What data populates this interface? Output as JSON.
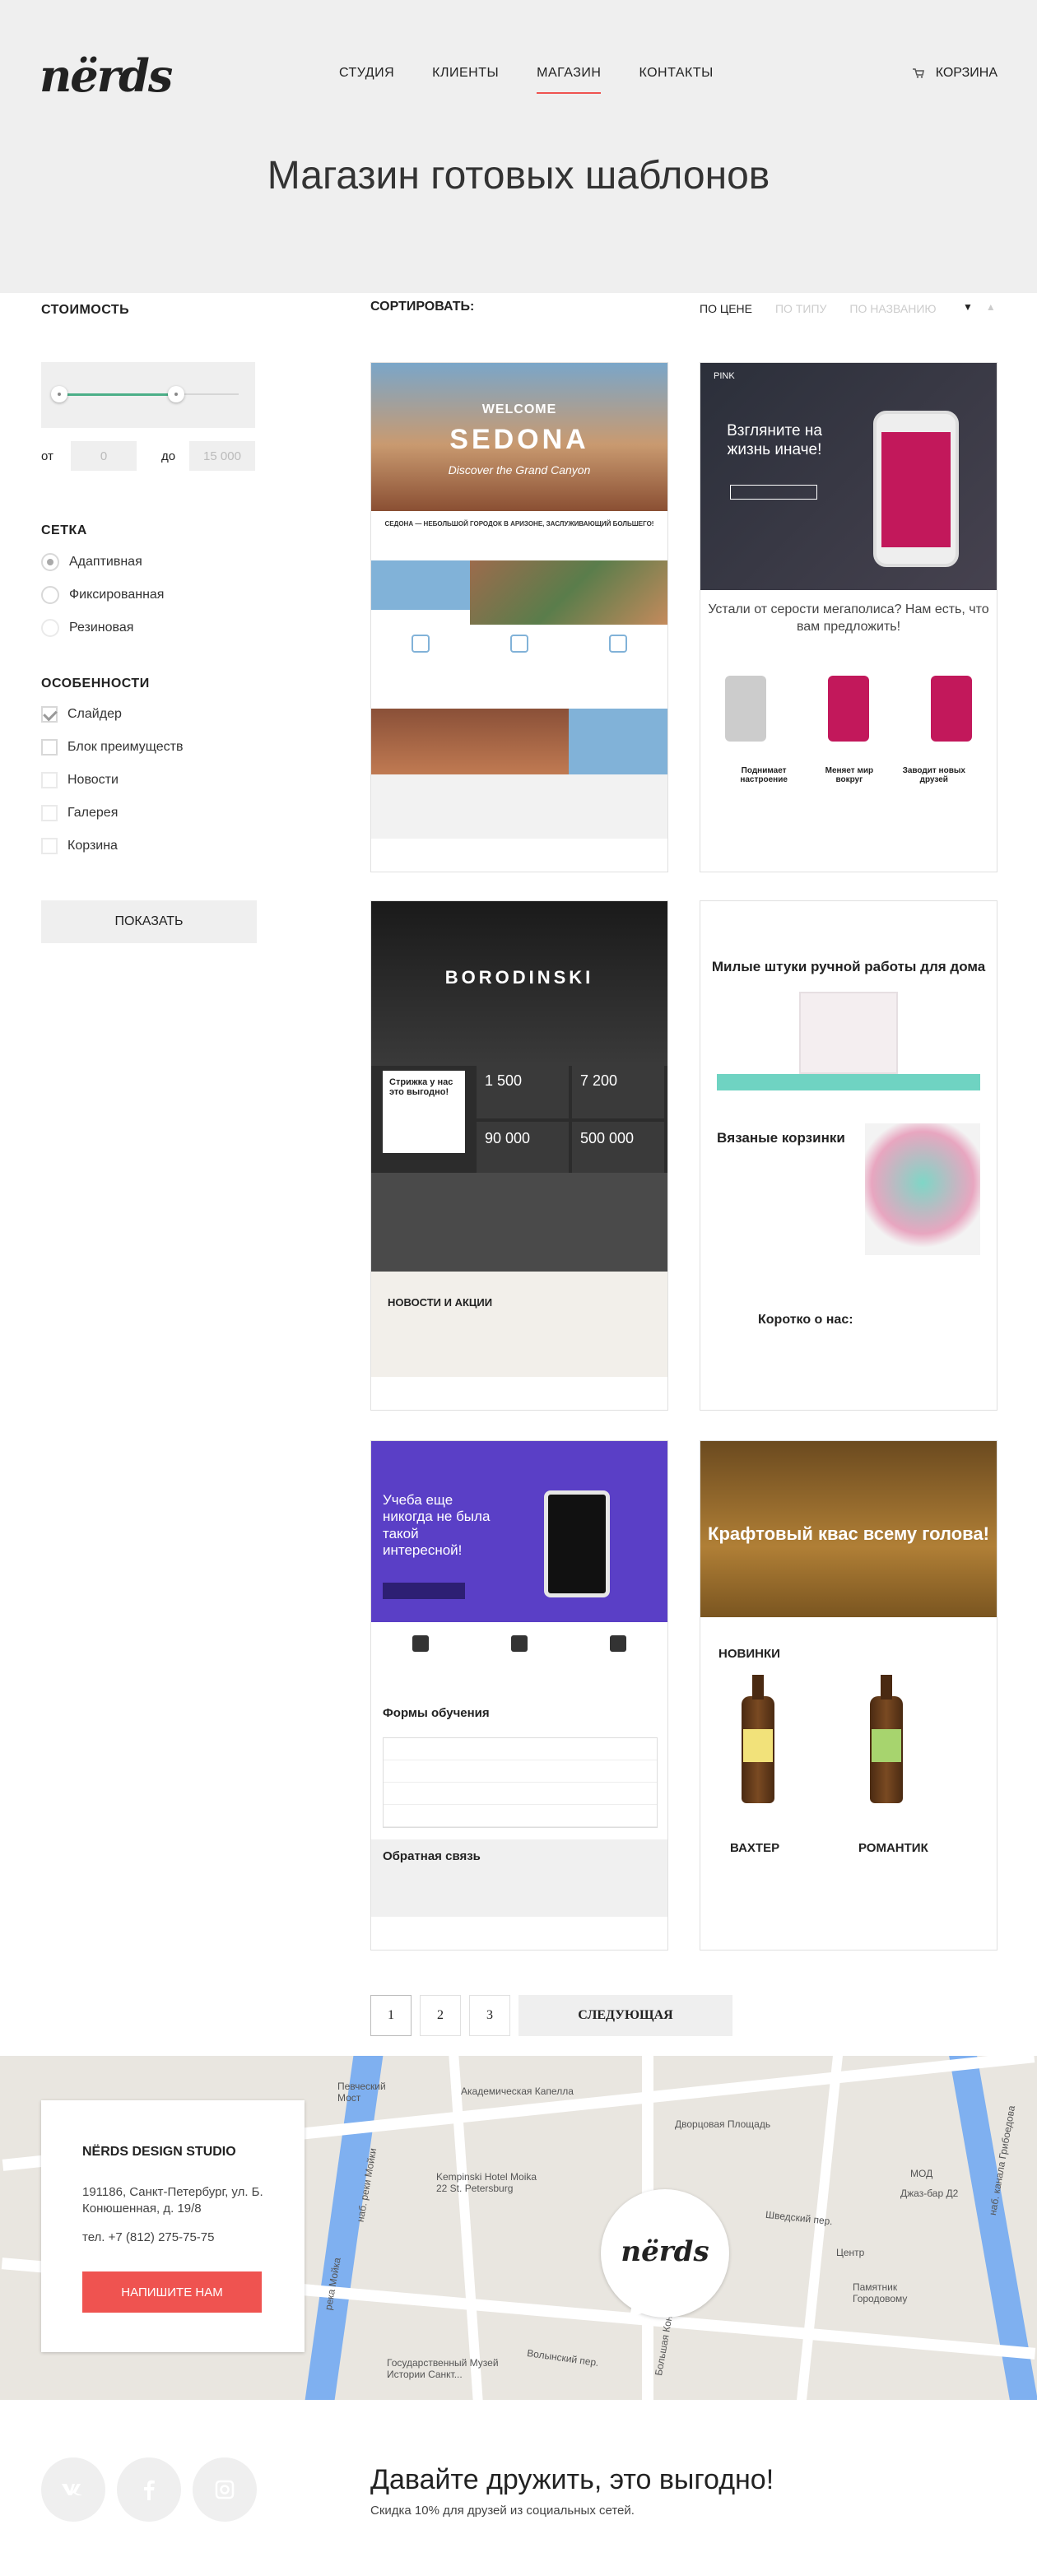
{
  "header": {
    "logo": "nërds",
    "nav": [
      "Студия",
      "Клиенты",
      "Магазин",
      "Контакты"
    ],
    "cart": "Корзина",
    "title": "Магазин готовых шаблонов"
  },
  "filters": {
    "price_heading": "Стоимость",
    "range": {
      "min_fraction": 0.0,
      "max_fraction": 0.66
    },
    "from_label": "от",
    "from_value": "0",
    "to_label": "до",
    "to_value": "15 000",
    "grid_heading": "Сетка",
    "grid_options": [
      "Адаптивная",
      "Фиксированная",
      "Резиновая"
    ],
    "grid_selected": "Адаптивная",
    "features_heading": "Особенности",
    "features": [
      "Слайдер",
      "Блок преимуществ",
      "Новости",
      "Галерея",
      "Корзина"
    ],
    "features_checked": [
      "Слайдер"
    ],
    "show_button": "Показать"
  },
  "sort": {
    "label": "Сортировать:",
    "options": [
      "По цене",
      "По типу",
      "По названию"
    ],
    "active": "По цене",
    "direction": "desc"
  },
  "templates": [
    {
      "id": "sedona",
      "text": {
        "welcome": "WELCOME",
        "name": "SEDONA",
        "tagline": "Discover the Grand Canyon",
        "sub": "СЕДОНА — НЕБОЛЬШОЙ ГОРОДОК В АРИЗОНЕ, ЗАСЛУЖИВАЮЩИЙ БОЛЬШЕГО!"
      }
    },
    {
      "id": "pink",
      "text": {
        "logo": "PINK",
        "hero": "Взгляните на жизнь иначе!",
        "question": "Устали от серости мегаполиса? Нам есть, что вам предложить!",
        "f1": "Поднимает настроение",
        "f2": "Меняет мир вокруг",
        "f3": "Заводит новых друзей"
      }
    },
    {
      "id": "borodinski",
      "text": {
        "name": "BORODINSKI",
        "promo": "Стрижка у нас это выгодно!",
        "s1": "1 500",
        "s2": "7 200",
        "s3": "90 000",
        "s4": "500 000",
        "news": "НОВОСТИ И АКЦИИ"
      }
    },
    {
      "id": "knit",
      "text": {
        "h1": "Милые штуки ручной работы для дома",
        "h2": "Вязаные корзинки",
        "h3": "Коротко о нас:"
      }
    },
    {
      "id": "education",
      "text": {
        "hero": "Учеба еще никогда не была такой интересной!",
        "forms": "Формы обучения",
        "feedback": "Обратная связь"
      }
    },
    {
      "id": "kvass",
      "text": {
        "hero": "Крафтовый квас всему голова!",
        "new": "НОВИНКИ",
        "b1": "ВАХТЕР",
        "b2": "РОМАНТИК"
      }
    }
  ],
  "pagination": {
    "pages": [
      "1",
      "2",
      "3"
    ],
    "current": "1",
    "next": "Следующая"
  },
  "map": {
    "streets": [
      "Академическая Капелла",
      "Дворцовая Площадь",
      "Kempinski Hotel Moika 22 St. Petersburg",
      "наб. реки Мойки",
      "Певческий Мост",
      "Шведский пер.",
      "Центр",
      "Джаз-бар Д2",
      "Памятник Городовому",
      "Государственный Музей Истории Санкт...",
      "Волынский пер.",
      "река Мойка",
      "наб. канала Грибоедова",
      "Большая Конюшенная ул.",
      "МОД"
    ],
    "company": "Nërds Design Studio",
    "address": "191186, Санкт-Петербург, ул. Б. Конюшенная, д. 19/8",
    "phone": "тел. +7 (812) 275-75-75",
    "button": "Напишите нам",
    "pin_logo": "nërds"
  },
  "footer": {
    "social": [
      "vk",
      "f",
      "instagram"
    ],
    "title": "Давайте дружить, это выгодно!",
    "subtitle": "Скидка 10% для друзей из социальных сетей."
  },
  "colors": {
    "accent": "#ef5350",
    "range": "#4caf88",
    "panel": "#efefef"
  }
}
